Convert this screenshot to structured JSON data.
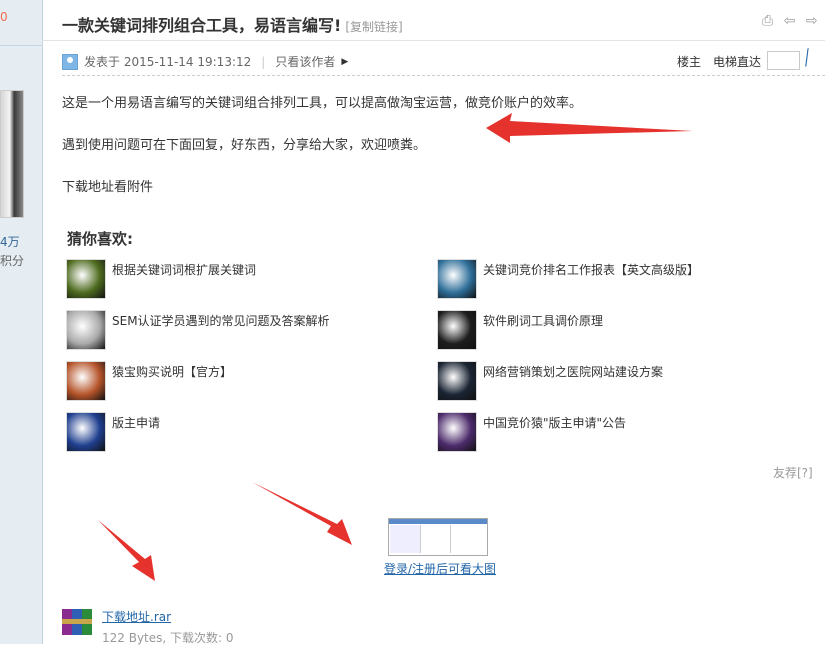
{
  "sidebar": {
    "top_number": "0",
    "stat_value": "4万",
    "stat_label": "积分"
  },
  "post": {
    "title": "一款关键词排列组合工具，易语言编写!",
    "copy_link": "[复制链接]",
    "tools": "⎙ ⇦ ⇨",
    "posted_at": "发表于 2015-11-14 19:13:12",
    "only_author": "只看该作者",
    "floor_label": "楼主",
    "jump_label": "电梯直达",
    "paragraphs": [
      "这是一个用易语言编写的关键词组合排列工具，可以提高做淘宝运营，做竞价账户的效率。",
      "遇到使用问题可在下面回复，好东西，分享给大家，欢迎喷粪。",
      "下载地址看附件"
    ]
  },
  "guess": {
    "heading": "猜你喜欢:",
    "items": [
      {
        "label": "根据关键词词根扩展关键词",
        "color": "#4e6b1f"
      },
      {
        "label": "关键词竞价排名工作报表【英文高级版】",
        "color": "#2f6f9a"
      },
      {
        "label": "SEM认证学员遇到的常见问题及答案解析",
        "color": "#aaaaaa"
      },
      {
        "label": "软件刷词工具调价原理",
        "color": "#1d1d1d"
      },
      {
        "label": "猿宝购买说明【官方】",
        "color": "#b5542a"
      },
      {
        "label": "网络营销策划之医院网站建设方案",
        "color": "#1a2433"
      },
      {
        "label": "版主申请",
        "color": "#1f3f8f"
      },
      {
        "label": "中国竞价猿\"版主申请\"公告",
        "color": "#4c2b6b"
      }
    ]
  },
  "friend_recommend": "友荐[?]",
  "attachment": {
    "image_link": "登录/注册后可看大图",
    "file_name": "下载地址.rar",
    "file_info": "122 Bytes, 下载次数: 0"
  },
  "colors": {
    "link": "#2366a8",
    "arrow": "#e5322d",
    "sidebar_bg": "#e5edf2"
  }
}
